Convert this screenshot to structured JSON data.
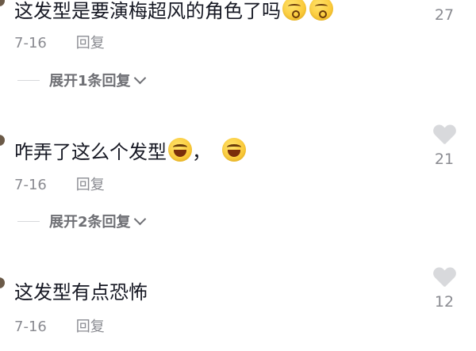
{
  "comments": [
    {
      "text": "这发型是要演梅超风的角色了吗",
      "date": "7-16",
      "reply_label": "回复",
      "likes": "27",
      "emojis": [
        "kiss-emoji",
        "kiss-emoji"
      ],
      "expand_label": "展开1条回复"
    },
    {
      "text": "咋弄了这么个发型",
      "text_suffix": "，",
      "date": "7-16",
      "reply_label": "回复",
      "likes": "21",
      "emojis": [
        "laugh-emoji",
        "laugh-emoji"
      ],
      "expand_label": "展开2条回复"
    },
    {
      "text": "这发型有点恐怖",
      "date": "7-16",
      "reply_label": "回复",
      "likes": "12"
    }
  ],
  "colors": {
    "text": "#161823",
    "meta": "#8a8b91",
    "heart": "#d8d9dc",
    "background": "#ffffff"
  }
}
